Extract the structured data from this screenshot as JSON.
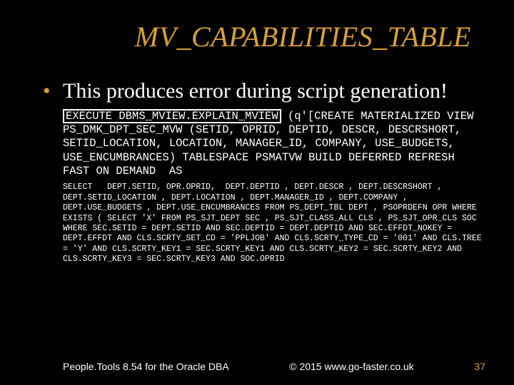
{
  "title": "MV_CAPABILITIES_TABLE",
  "bullet": "This produces error during script generation!",
  "code1": {
    "boxed": "EXECUTE DBMS_MVIEW.EXPLAIN_MVIEW",
    "rest": " (q'[CREATE MATERIALIZED VIEW PS_DMK_DPT_SEC_MVW (SETID, OPRID, DEPTID, DESCR, DESCRSHORT, SETID_LOCATION, LOCATION, MANAGER_ID, COMPANY, USE_BUDGETS, USE_ENCUMBRANCES) TABLESPACE PSMATVW BUILD DEFERRED REFRESH FAST ON DEMAND  AS"
  },
  "code2": "SELECT   DEPT.SETID, OPR.OPRID,  DEPT.DEPTID , DEPT.DESCR , DEPT.DESCRSHORT , DEPT.SETID_LOCATION , DEPT.LOCATION , DEPT.MANAGER_ID , DEPT.COMPANY , DEPT.USE_BUDGETS , DEPT.USE_ENCUMBRANCES FROM PS_DEPT_TBL DEPT , PSOPRDEFN OPR WHERE EXISTS ( SELECT 'X' FROM PS_SJT_DEPT SEC , PS_SJT_CLASS_ALL CLS , PS_SJT_OPR_CLS SOC WHERE SEC.SETID = DEPT.SETID AND SEC.DEPTID = DEPT.DEPTID AND SEC.EFFDT_NOKEY = DEPT.EFFDT AND CLS.SCRTY_SET_CD = 'PPLJOB' AND CLS.SCRTY_TYPE_CD = '001' AND CLS.TREE = 'Y' AND CLS.SCRTY_KEY1 = SEC.SCRTY_KEY1 AND CLS.SCRTY_KEY2 = SEC.SCRTY_KEY2 AND CLS.SCRTY_KEY3 = SEC.SCRTY_KEY3 AND SOC.OPRID",
  "footer": {
    "left": "People.Tools 8.54 for the Oracle DBA",
    "center": "© 2015 www.go-faster.co.uk",
    "right": "37"
  }
}
